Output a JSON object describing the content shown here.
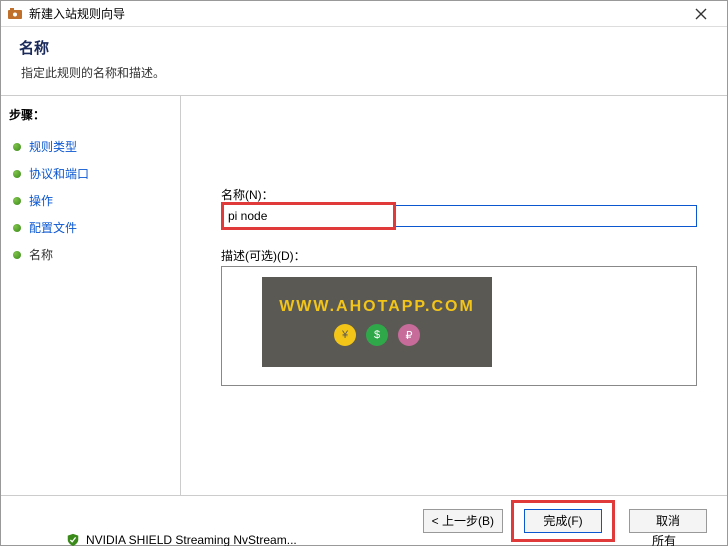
{
  "window": {
    "title": "新建入站规则向导"
  },
  "header": {
    "heading": "名称",
    "subheading": "指定此规则的名称和描述。"
  },
  "sidebar": {
    "stepsHeading": "步骤：",
    "steps": [
      {
        "label": "规则类型",
        "link": true
      },
      {
        "label": "协议和端口",
        "link": true
      },
      {
        "label": "操作",
        "link": true
      },
      {
        "label": "配置文件",
        "link": true
      },
      {
        "label": "名称",
        "link": false
      }
    ]
  },
  "form": {
    "nameLabel": "名称(N)：",
    "nameValue": "pi node",
    "descLabel": "描述(可选)(D)："
  },
  "watermark": {
    "url": "WWW.AHOTAPP.COM",
    "d1": "¥",
    "d2": "$",
    "d3": "₽"
  },
  "buttons": {
    "back": "< 上一步(B)",
    "finish": "完成(F)",
    "cancel": "取消"
  },
  "strip": {
    "text": "NVIDIA SHIELD Streaming NvStream...",
    "filter": "所有"
  }
}
